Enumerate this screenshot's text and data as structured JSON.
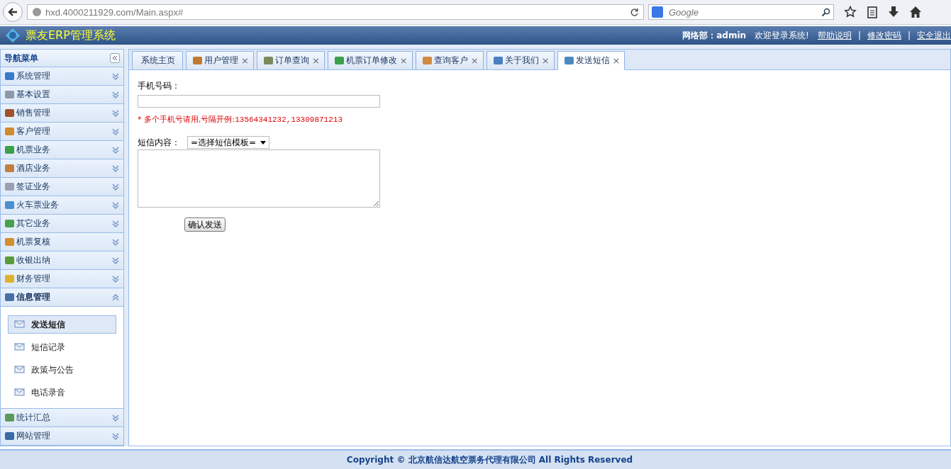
{
  "browser": {
    "url": "hxd.4000211929.com/Main.aspx#",
    "search": {
      "placeholder": "Google"
    }
  },
  "header": {
    "title": "票友ERP管理系统",
    "user": "网络部：admin",
    "welcome": "欢迎登录系统!",
    "links": [
      "帮助说明",
      "修改密码",
      "安全退出"
    ],
    "separator": "|"
  },
  "sidebar": {
    "title": "导航菜单",
    "groups": [
      {
        "label": "系统管理",
        "expanded": false
      },
      {
        "label": "基本设置",
        "expanded": false
      },
      {
        "label": "销售管理",
        "expanded": false
      },
      {
        "label": "客户管理",
        "expanded": false
      },
      {
        "label": "机票业务",
        "expanded": false
      },
      {
        "label": "酒店业务",
        "expanded": false
      },
      {
        "label": "签证业务",
        "expanded": false
      },
      {
        "label": "火车票业务",
        "expanded": false
      },
      {
        "label": "其它业务",
        "expanded": false
      },
      {
        "label": "机票复核",
        "expanded": false
      },
      {
        "label": "收银出纳",
        "expanded": false
      },
      {
        "label": "财务管理",
        "expanded": false
      },
      {
        "label": "信息管理",
        "expanded": true,
        "children": [
          {
            "label": "发送短信",
            "selected": true
          },
          {
            "label": "短信记录",
            "selected": false
          },
          {
            "label": "政策与公告",
            "selected": false
          },
          {
            "label": "电话录音",
            "selected": false
          }
        ]
      },
      {
        "label": "统计汇总",
        "expanded": false
      },
      {
        "label": "网站管理",
        "expanded": false
      }
    ]
  },
  "tabs": [
    {
      "label": "系统主页",
      "selected": false,
      "closable": false
    },
    {
      "label": "用户管理",
      "selected": false,
      "closable": true
    },
    {
      "label": "订单查询",
      "selected": false,
      "closable": true
    },
    {
      "label": "机票订单修改",
      "selected": false,
      "closable": true
    },
    {
      "label": "查询客户",
      "selected": false,
      "closable": true
    },
    {
      "label": "关于我们",
      "selected": false,
      "closable": true
    },
    {
      "label": "发送短信",
      "selected": true,
      "closable": true
    }
  ],
  "close_glyph": "×",
  "form": {
    "phone_label": "手机号码：",
    "hint_mark": "*",
    "hint": "多个手机号请用,号隔开例:",
    "hint_example": "13564341232,13309871213",
    "content_label": "短信内容：",
    "template_select": "=选择短信模板=",
    "submit": "确认发送"
  },
  "footer": "Copyright © 北京航信达航空票务代理有限公司 All Rights Reserved"
}
